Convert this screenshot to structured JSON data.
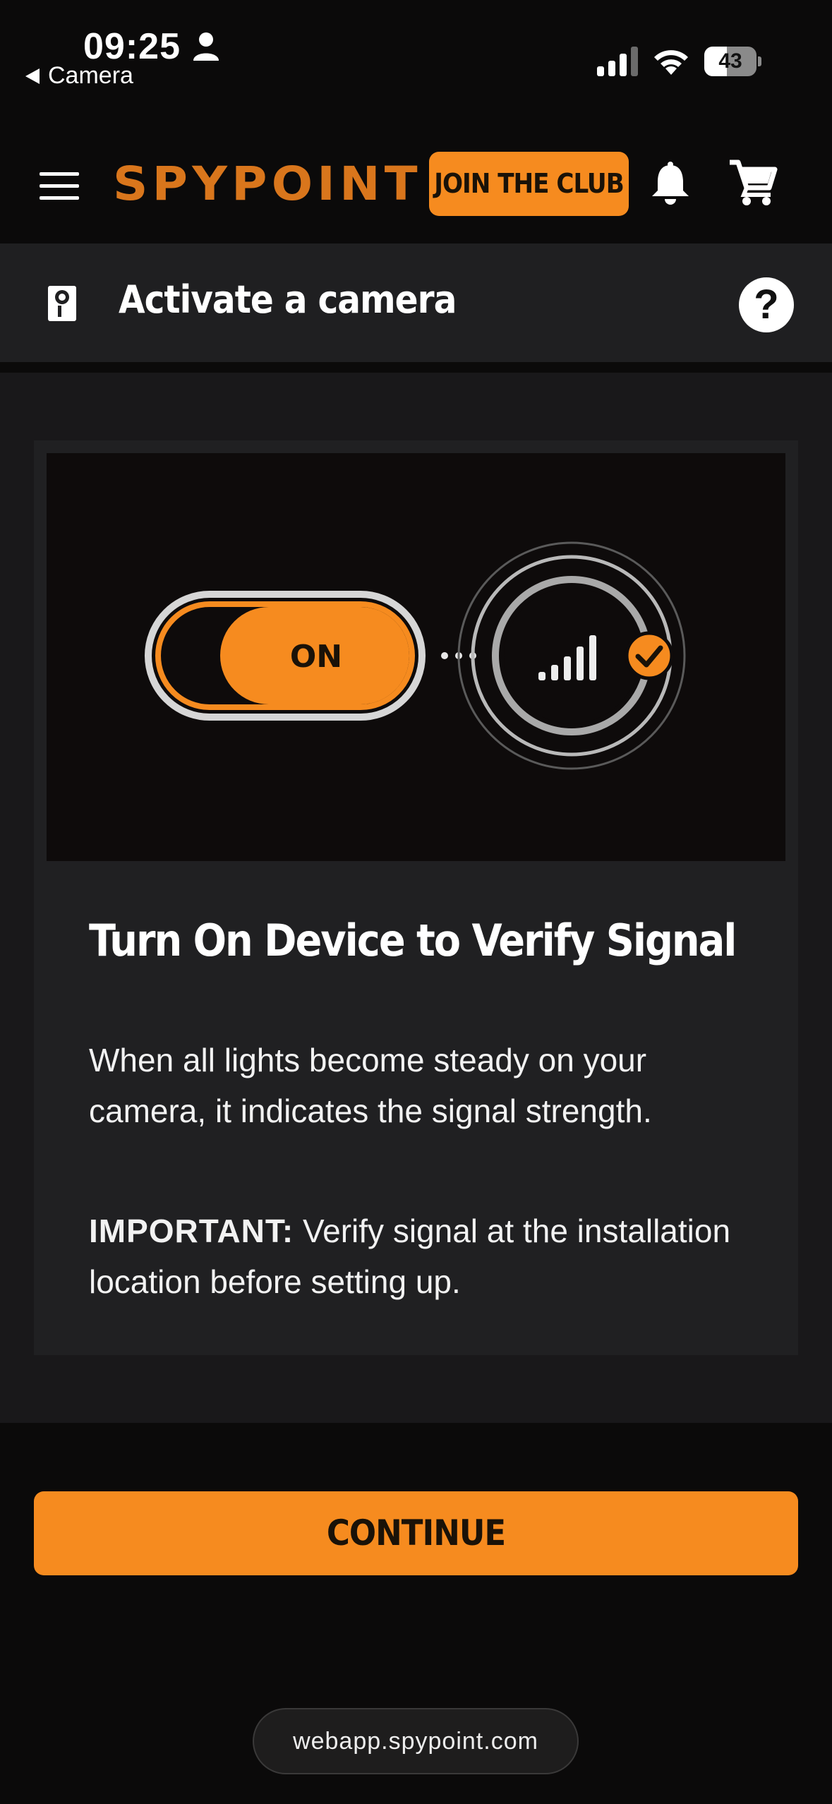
{
  "status_bar": {
    "time": "09:25",
    "back_label": "Camera",
    "battery": "43",
    "battery_level": 0.43,
    "icons": [
      "person-icon",
      "cellular-signal-icon",
      "wifi-icon",
      "battery-icon"
    ]
  },
  "header": {
    "brand": "SPYPOINT",
    "join_label": "JOIN THE CLUB",
    "icons": [
      "menu-icon",
      "bell-icon",
      "cart-icon"
    ],
    "accent_color": "#f68b1f"
  },
  "subheader": {
    "title": "Activate a camera",
    "help_symbol": "?"
  },
  "card": {
    "illustration": {
      "switch_label": "ON",
      "connector": "···"
    },
    "title": "Turn On Device to Verify Signal",
    "paragraph_1": "When all lights become steady on your camera, it indicates the signal strength.",
    "important_label": "IMPORTANT:",
    "paragraph_2": " Verify signal at the installation location before setting up."
  },
  "footer": {
    "continue_label": "CONTINUE",
    "url": "webapp.spypoint.com"
  }
}
